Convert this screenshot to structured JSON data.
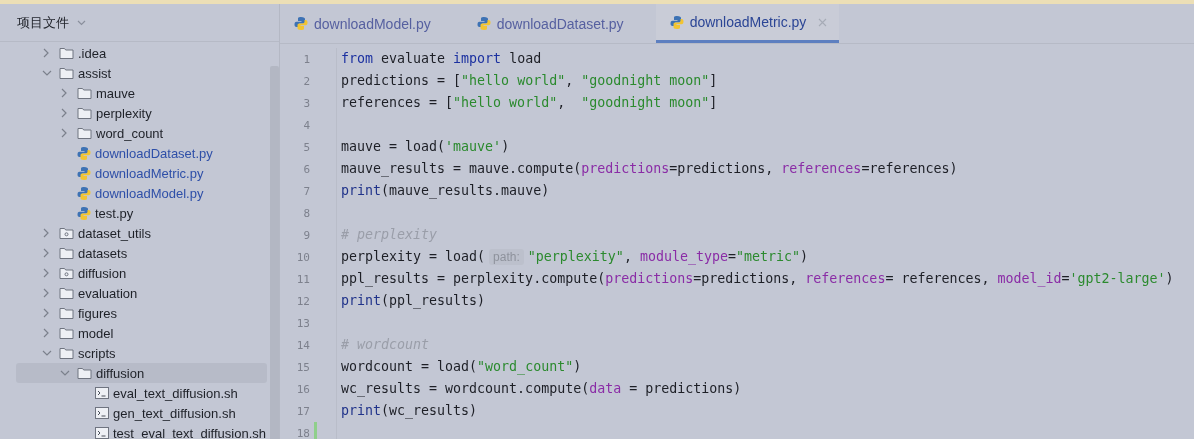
{
  "project_panel": {
    "title": "项目文件",
    "tree": [
      {
        "name": ".idea",
        "kind": "folder",
        "expanded": false,
        "selected": false,
        "modified": false
      },
      {
        "name": "assist",
        "kind": "folder",
        "expanded": true,
        "selected": false,
        "modified": false,
        "children": [
          {
            "name": "mauve",
            "kind": "folder",
            "expanded": false,
            "selected": false,
            "modified": false
          },
          {
            "name": "perplexity",
            "kind": "folder",
            "expanded": false,
            "selected": false,
            "modified": false
          },
          {
            "name": "word_count",
            "kind": "folder",
            "expanded": false,
            "selected": false,
            "modified": false
          },
          {
            "name": "downloadDataset.py",
            "kind": "python",
            "selected": false,
            "modified": true
          },
          {
            "name": "downloadMetric.py",
            "kind": "python",
            "selected": false,
            "modified": true
          },
          {
            "name": "downloadModel.py",
            "kind": "python",
            "selected": false,
            "modified": true
          },
          {
            "name": "test.py",
            "kind": "python",
            "selected": false,
            "modified": false
          }
        ]
      },
      {
        "name": "dataset_utils",
        "kind": "package",
        "expanded": false,
        "selected": false,
        "modified": false
      },
      {
        "name": "datasets",
        "kind": "folder",
        "expanded": false,
        "selected": false,
        "modified": false
      },
      {
        "name": "diffusion",
        "kind": "package",
        "expanded": false,
        "selected": false,
        "modified": false
      },
      {
        "name": "evaluation",
        "kind": "folder",
        "expanded": false,
        "selected": false,
        "modified": false
      },
      {
        "name": "figures",
        "kind": "folder",
        "expanded": false,
        "selected": false,
        "modified": false
      },
      {
        "name": "model",
        "kind": "folder",
        "expanded": false,
        "selected": false,
        "modified": false
      },
      {
        "name": "scripts",
        "kind": "folder",
        "expanded": true,
        "selected": false,
        "modified": false,
        "children": [
          {
            "name": "diffusion",
            "kind": "folder",
            "expanded": true,
            "selected": true,
            "modified": false,
            "children": [
              {
                "name": "eval_text_diffusion.sh",
                "kind": "shell",
                "selected": false,
                "modified": false
              },
              {
                "name": "gen_text_diffusion.sh",
                "kind": "shell",
                "selected": false,
                "modified": false
              },
              {
                "name": "test_eval_text_diffusion.sh",
                "kind": "shell",
                "selected": false,
                "modified": false
              }
            ]
          }
        ]
      }
    ]
  },
  "tabs": [
    {
      "label": "downloadModel.py",
      "selected": false
    },
    {
      "label": "downloadDataset.py",
      "selected": false
    },
    {
      "label": "downloadMetric.py",
      "selected": true
    }
  ],
  "editor": {
    "lines": [
      {
        "number": "1",
        "added": false,
        "tokens": [
          {
            "kind": "keyword",
            "text": "from"
          },
          {
            "kind": "plain",
            "text": " evaluate "
          },
          {
            "kind": "keyword",
            "text": "import"
          },
          {
            "kind": "plain",
            "text": " load"
          }
        ]
      },
      {
        "number": "2",
        "added": false,
        "tokens": [
          {
            "kind": "plain",
            "text": "predictions = ["
          },
          {
            "kind": "string",
            "text": "\"hello world\""
          },
          {
            "kind": "plain",
            "text": ", "
          },
          {
            "kind": "string",
            "text": "\"goodnight moon\""
          },
          {
            "kind": "plain",
            "text": "]"
          }
        ]
      },
      {
        "number": "3",
        "added": false,
        "tokens": [
          {
            "kind": "plain",
            "text": "references = ["
          },
          {
            "kind": "string",
            "text": "\"hello world\""
          },
          {
            "kind": "plain",
            "text": ",  "
          },
          {
            "kind": "string",
            "text": "\"goodnight moon\""
          },
          {
            "kind": "plain",
            "text": "]"
          }
        ]
      },
      {
        "number": "4",
        "added": false
      },
      {
        "number": "5",
        "added": false,
        "tokens": [
          {
            "kind": "plain",
            "text": "mauve = load("
          },
          {
            "kind": "string",
            "text": "'mauve'"
          },
          {
            "kind": "plain",
            "text": ")"
          }
        ]
      },
      {
        "number": "6",
        "added": false,
        "tokens": [
          {
            "kind": "plain",
            "text": "mauve_results = mauve.compute("
          },
          {
            "kind": "param",
            "text": "predictions"
          },
          {
            "kind": "plain",
            "text": "=predictions, "
          },
          {
            "kind": "param",
            "text": "references"
          },
          {
            "kind": "plain",
            "text": "=references)"
          }
        ]
      },
      {
        "number": "7",
        "added": false,
        "tokens": [
          {
            "kind": "builtin",
            "text": "print"
          },
          {
            "kind": "plain",
            "text": "(mauve_results.mauve)"
          }
        ]
      },
      {
        "number": "8",
        "added": false
      },
      {
        "number": "9",
        "added": false,
        "tokens": [
          {
            "kind": "comment",
            "text": "# perplexity"
          }
        ]
      },
      {
        "number": "10",
        "added": false,
        "tokens": [
          {
            "kind": "plain",
            "text": "perplexity = load("
          },
          {
            "kind": "hint",
            "text": "path:"
          },
          {
            "kind": "string",
            "text": "\"perplexity\""
          },
          {
            "kind": "plain",
            "text": ", "
          },
          {
            "kind": "param",
            "text": "module_type"
          },
          {
            "kind": "plain",
            "text": "="
          },
          {
            "kind": "string",
            "text": "\"metric\""
          },
          {
            "kind": "plain",
            "text": ")"
          }
        ]
      },
      {
        "number": "11",
        "added": false,
        "tokens": [
          {
            "kind": "plain",
            "text": "ppl_results = perplexity.compute("
          },
          {
            "kind": "param",
            "text": "predictions"
          },
          {
            "kind": "plain",
            "text": "=predictions, "
          },
          {
            "kind": "param",
            "text": "references"
          },
          {
            "kind": "plain",
            "text": "= references, "
          },
          {
            "kind": "param",
            "text": "model_id"
          },
          {
            "kind": "plain",
            "text": "="
          },
          {
            "kind": "string",
            "text": "'gpt2-large'"
          },
          {
            "kind": "plain",
            "text": ")"
          }
        ]
      },
      {
        "number": "12",
        "added": false,
        "tokens": [
          {
            "kind": "builtin",
            "text": "print"
          },
          {
            "kind": "plain",
            "text": "(ppl_results)"
          }
        ]
      },
      {
        "number": "13",
        "added": false
      },
      {
        "number": "14",
        "added": false,
        "tokens": [
          {
            "kind": "comment",
            "text": "# wordcount"
          }
        ]
      },
      {
        "number": "15",
        "added": false,
        "tokens": [
          {
            "kind": "plain",
            "text": "wordcount = load("
          },
          {
            "kind": "string",
            "text": "\"word_count\""
          },
          {
            "kind": "plain",
            "text": ")"
          }
        ]
      },
      {
        "number": "16",
        "added": false,
        "tokens": [
          {
            "kind": "plain",
            "text": "wc_results = wordcount.compute("
          },
          {
            "kind": "param",
            "text": "data"
          },
          {
            "kind": "plain",
            "text": " = predictions)"
          }
        ]
      },
      {
        "number": "17",
        "added": false,
        "tokens": [
          {
            "kind": "builtin",
            "text": "print"
          },
          {
            "kind": "plain",
            "text": "(wc_results)"
          }
        ]
      },
      {
        "number": "18",
        "added": true
      }
    ]
  }
}
